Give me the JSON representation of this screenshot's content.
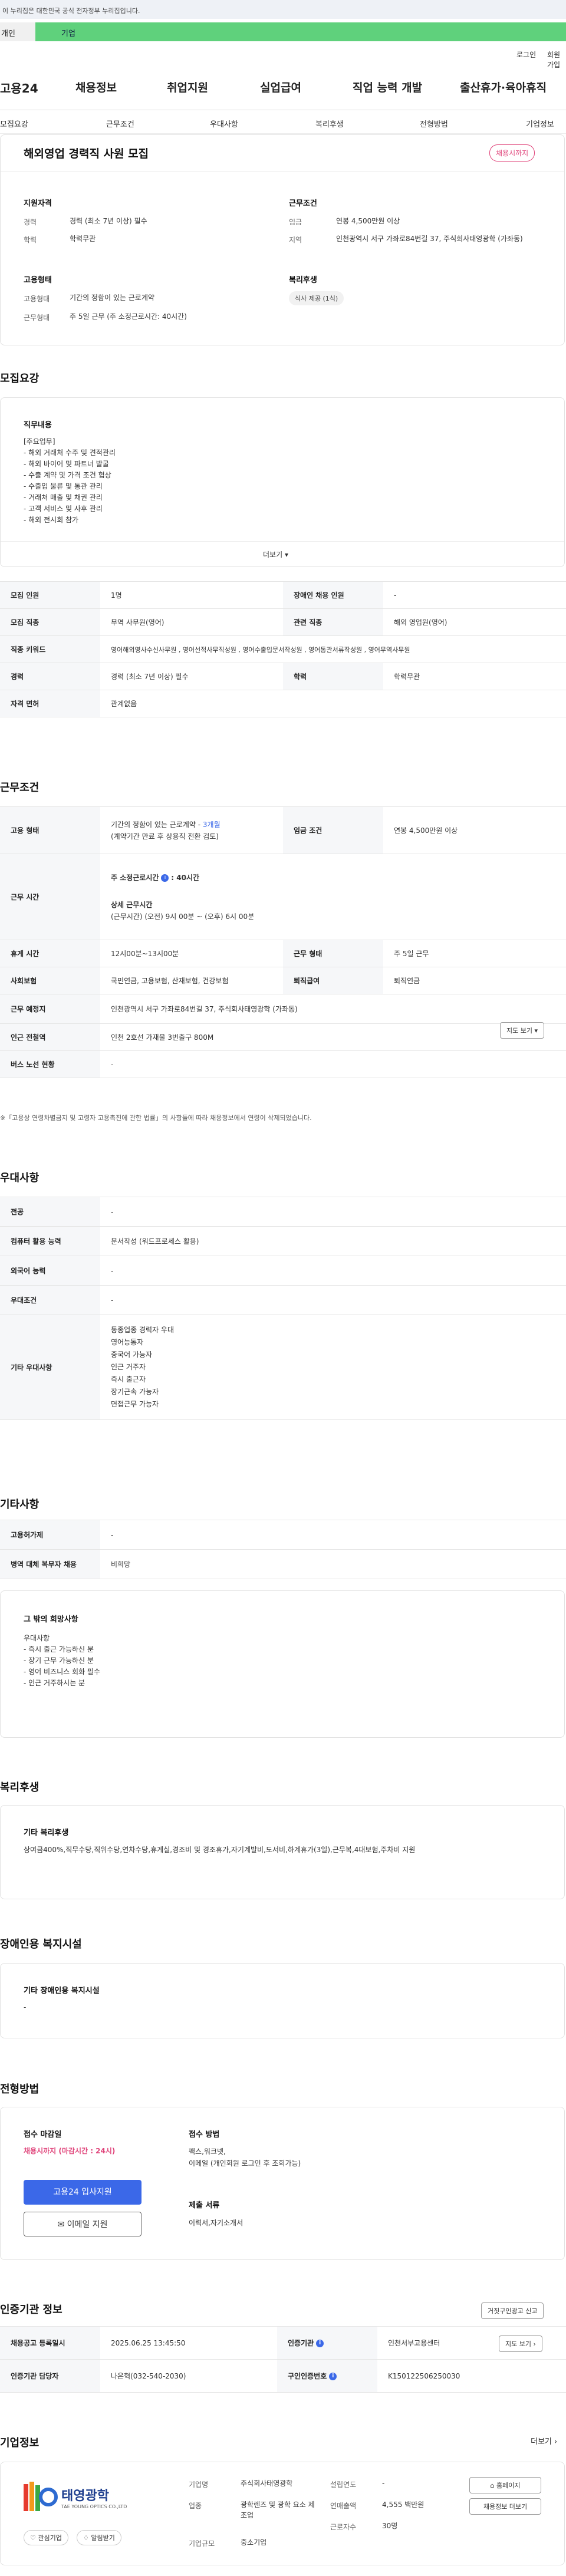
{
  "gov_banner": "이 누리집은 대한민국 공식 전자정부 누리집입니다.",
  "tabs": {
    "personal": "개인",
    "company": "기업"
  },
  "util": {
    "login": "로그인",
    "signup": "회원가입"
  },
  "logo": "고용24",
  "gnb": [
    "채용정보",
    "취업지원",
    "실업급여",
    "직업 능력 개발",
    "출산휴가·육아휴직"
  ],
  "anchor_nav": [
    "모집요강",
    "근무조건",
    "우대사항",
    "복리후생",
    "전형방법",
    "기업정보"
  ],
  "summary": {
    "title": "해외영업 경력직 사원 모집",
    "badge": "채용시까지",
    "qual_title": "지원자격",
    "career_lbl": "경력",
    "career_val": "경력 (최소 7년 이상) 필수",
    "edu_lbl": "학력",
    "edu_val": "학력무관",
    "cond_title": "근무조건",
    "wage_lbl": "임금",
    "wage_val": "연봉 4,500만원 이상",
    "loc_lbl": "지역",
    "loc_val": "인천광역시 서구 가좌로84번길 37, 주식회사태영광학 (가좌동)",
    "emp_title": "고용형태",
    "emp_lbl": "고용형태",
    "emp_val": "기간의 정함이 있는 근로계약",
    "hours_lbl": "근무형태",
    "hours_val": "주 5일 근무 (주 소정근로시간: 40시간)",
    "welfare_title": "복리후생",
    "welfare_tag": "식사 제공 (1식)"
  },
  "recruit": {
    "heading": "모집요강",
    "duty_title": "직무내용",
    "duty_lines": [
      "[주요업무]",
      "- 해외 거래처 수주 및 견적관리",
      "- 해외 바이어 및 파트너 발굴",
      "- 수출 계약 및 가격 조건 협상",
      "- 수출입 물류 및 통관 관리",
      "- 거래처 매출 및 채권 관리",
      "- 고객 서비스 및 사후 관리",
      "- 해외 전시회 참가"
    ],
    "more": "더보기",
    "rows": [
      {
        "h1": "모집 인원",
        "v1": "1명",
        "h2": "장애인 채용 인원",
        "v2": "-"
      },
      {
        "h1": "모집 직종",
        "v1": "무역 사무원(영어)",
        "h2": "관련 직종",
        "v2": "해외 영업원(영어)"
      },
      {
        "h1": "직종 키워드",
        "v1": "영어해외영사수신사무원 , 영어선적사무직성원 , 영어수출입문서작성원 , 영어통관서류작성원 , 영어무역사무원",
        "h2": "",
        "v2": ""
      },
      {
        "h1": "경력",
        "v1": "경력 (최소 7년 이상) 필수",
        "h2": "학력",
        "v2": "학력무관"
      },
      {
        "h1": "자격 면허",
        "v1": "관계없음",
        "h2": "",
        "v2": ""
      }
    ]
  },
  "work": {
    "heading": "근무조건",
    "emp_h": "고용 형태",
    "emp_v1": "기간의 정함이 있는 근로계약 - ",
    "emp_v1b": "3개월",
    "emp_v2": "(계약기간 만료 후 상용직 전환 검토)",
    "wage_h": "임금 조건",
    "wage_v": "연봉 4,500만원 이상",
    "time_h": "근무 시간",
    "weekly": "주 소정근로시간",
    "weekly_v": ": 40시간",
    "detail_t": "상세 근무시간",
    "detail_v": "(근무시간) (오전) 9시 00분 ~ (오후) 6시 00분",
    "break_h": "휴게 시간",
    "break_v": "12시00분~13시00분",
    "type_h": "근무 형태",
    "type_v": "주 5일 근무",
    "ins_h": "사회보험",
    "ins_v": "국민연금, 고용보험, 산재보험, 건강보험",
    "ret_h": "퇴직급여",
    "ret_v": "퇴직연금",
    "addr_h": "근무 예정지",
    "addr_v": "인천광역시 서구 가좌로84번길 37, 주식회사태영광학 (가좌동)",
    "map": "지도 보기",
    "sub_h": "인근 전철역",
    "sub_v": "인천 2호선 가재울 3번출구 800M",
    "bus_h": "버스 노선 현황",
    "bus_v": "-",
    "note": "※「고용상 연령차별금지 및 고령자 고용촉진에 관한 법률」의 사항들에 따라 채용정보에서 연령이 삭제되었습니다."
  },
  "prefer": {
    "heading": "우대사항",
    "rows": [
      {
        "h": "전공",
        "v": [
          "-"
        ]
      },
      {
        "h": "컴퓨터 활용 능력",
        "v": [
          "문서작성 (워드프로세스 활용)"
        ]
      },
      {
        "h": "외국어 능력",
        "v": [
          "-"
        ]
      },
      {
        "h": "우대조건",
        "v": [
          "-"
        ]
      },
      {
        "h": "기타 우대사항",
        "v": [
          "동종업종 경력자 우대",
          "영어능통자",
          "중국어 가능자",
          "인근 거주자",
          "즉시 출근자",
          "장기근속 가능자",
          "면접근무 가능자"
        ]
      }
    ]
  },
  "etc": {
    "heading": "기타사항",
    "rows": [
      {
        "h": "고용허가제",
        "v": "-"
      },
      {
        "h": "병역 대체 복무자 채용",
        "v": "비희망"
      }
    ],
    "box_title": "그 밖의 희망사항",
    "box_lines": [
      "우대사항",
      "- 즉시 출근 가능하신 분",
      "- 장기 근무 가능하신 분",
      "- 영어 비즈니스 회화 필수",
      "- 인근 거주하시는 분"
    ]
  },
  "welfare": {
    "heading": "복리후생",
    "title": "기타 복리후생",
    "text": "상여금400%,직무수당,직위수당,연차수당,휴게실,경조비 및 경조휴가,자기계발비,도서비,하계휴가(3일),근무복,4대보험,주차비 지원"
  },
  "disabled": {
    "heading": "장애인용 복지시설",
    "title": "기타 장애인용 복지시설",
    "value": "-"
  },
  "process": {
    "heading": "전형방법",
    "deadline_t": "접수 마감일",
    "deadline_v": "채용시까지 (마감시간 : 24시)",
    "apply_btn": "고용24 입사지원",
    "email_btn": "이메일 지원",
    "method_t": "접수 방법",
    "method_v": [
      "팩스,워크넷,",
      "이메일 (개인회원 로그인 후 조회가능)"
    ],
    "docs_t": "제출 서류",
    "docs_v": "이력서,자기소개서"
  },
  "jobinfo": {
    "heading": "인증기관 정보",
    "report_btn": "거짓구인광고 신고",
    "reg_h": "채용공고 등록일시",
    "reg_v": "2025.06.25 13:45:50",
    "org_h": "인증기관",
    "org_v": "인천서부고용센터",
    "map": "지도 보기",
    "mgr_h": "인증기관 담당자",
    "mgr_v": "나은혁(032-540-2030)",
    "num_h": "구인인증번호",
    "num_v": "K150122506250030"
  },
  "company": {
    "heading": "기업정보",
    "more": "더보기",
    "logo_text": "태영광학",
    "logo_sub": "TAE YOUNG OPTICS CO.,LTD",
    "interest": "관심기업",
    "subscribe": "알림받기",
    "k1": "기업명",
    "v1": "주식회사태영광학",
    "k2": "업종",
    "v2": "광학렌즈 및 광학 요소 제조업",
    "k3": "기업규모",
    "v3": "중소기업",
    "k4": "설립연도",
    "v4": "-",
    "k5": "연매출액",
    "v5": "4,555 백만원",
    "k6": "근로자수",
    "v6": "30명",
    "home_btn": "홈페이지",
    "list_btn": "채용정보 더보기"
  },
  "icons": [
    "info-icon",
    "chevron-down-icon",
    "chevron-right-icon",
    "mail-icon",
    "heart-icon",
    "bell-icon",
    "home-icon"
  ]
}
